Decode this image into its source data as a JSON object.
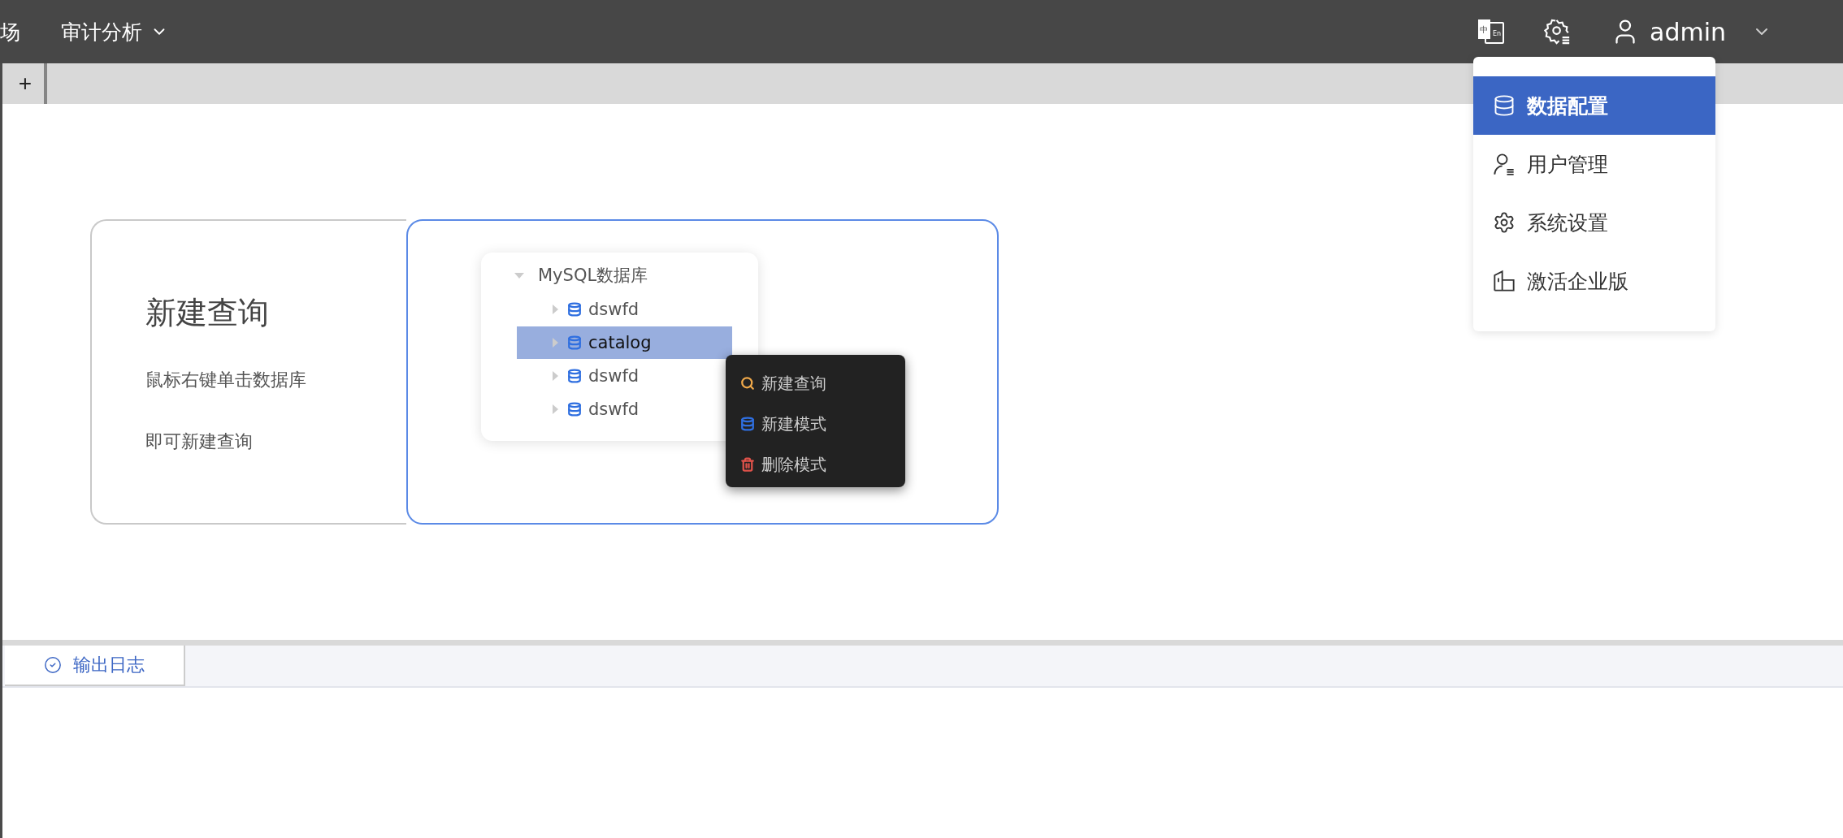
{
  "header": {
    "nav": [
      {
        "label": "场",
        "dropdown": false
      },
      {
        "label": "审计分析",
        "dropdown": true
      }
    ],
    "language_icon": {
      "primary": "中",
      "secondary": "En"
    },
    "user": {
      "name": "admin"
    }
  },
  "tab_strip": {
    "add_label": "+"
  },
  "guide_card": {
    "title": "新建查询",
    "lines": [
      "鼠标右键单击数据库",
      "即可新建查询"
    ],
    "illustration": {
      "tree": {
        "label": "MySQL数据库",
        "expanded": true,
        "children": [
          {
            "label": "dswfd",
            "selected": false
          },
          {
            "label": "catalog",
            "selected": true
          },
          {
            "label": "dswfd",
            "selected": false
          },
          {
            "label": "dswfd",
            "selected": false
          }
        ]
      },
      "context_menu": [
        {
          "label": "新建查询",
          "kind": "query"
        },
        {
          "label": "新建模式",
          "kind": "schema"
        },
        {
          "label": "删除模式",
          "kind": "delete"
        }
      ]
    }
  },
  "bottom_panel": {
    "tabs": [
      {
        "label": "输出日志",
        "selected": true
      }
    ]
  },
  "user_menu": [
    {
      "label": "数据配置",
      "kind": "data",
      "selected": true
    },
    {
      "label": "用户管理",
      "kind": "users",
      "selected": false
    },
    {
      "label": "系统设置",
      "kind": "settings",
      "selected": false
    },
    {
      "label": "激活企业版",
      "kind": "activate",
      "selected": false
    }
  ]
}
